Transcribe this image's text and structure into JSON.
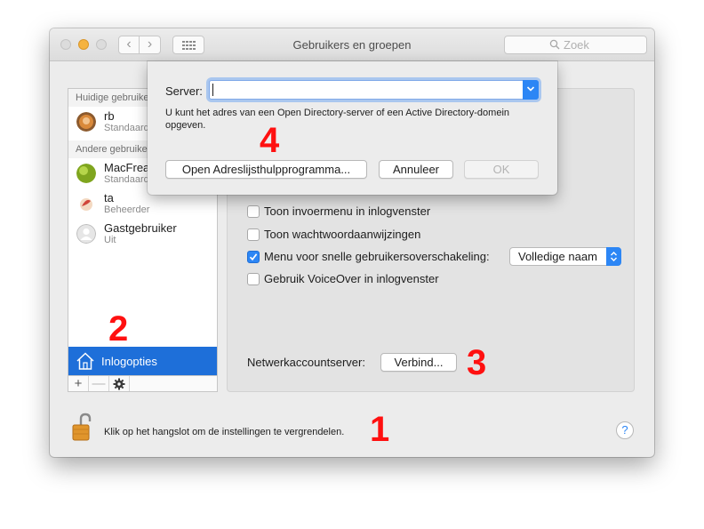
{
  "window": {
    "title": "Gebruikers en groepen",
    "search_placeholder": "Zoek"
  },
  "sidebar": {
    "current_header": "Huidige gebruiker",
    "other_header": "Andere gebruikers",
    "current_user": {
      "name": "rb",
      "role": "Standaard"
    },
    "users": [
      {
        "name": "MacFreak",
        "role": "Standaard"
      },
      {
        "name": "ta",
        "role": "Beheerder"
      },
      {
        "name": "Gastgebruiker",
        "role": "Uit"
      }
    ],
    "login_options": "Inlogopties",
    "tools": {
      "add": "+",
      "remove": "—"
    }
  },
  "panel": {
    "options": [
      {
        "label": "Toon invoermenu in inlogvenster",
        "checked": false
      },
      {
        "label": "Toon wachtwoordaanwijzingen",
        "checked": false
      },
      {
        "label": "Menu voor snelle gebruikersoverschakeling:",
        "checked": true
      },
      {
        "label": "Gebruik VoiceOver in inlogvenster",
        "checked": false
      }
    ],
    "fast_switch_value": "Volledige naam",
    "network_label": "Netwerkaccountserver:",
    "join_button": "Verbind..."
  },
  "footer": {
    "lock_text": "Klik op het hangslot om de instellingen te vergrendelen.",
    "help": "?"
  },
  "sheet": {
    "server_label": "Server:",
    "server_value": "",
    "help_text": "U kunt het adres van een Open Directory-server of een Active Directory-domein opgeven.",
    "open_utility_button": "Open Adreslijsthulpprogramma...",
    "cancel_button": "Annuleer",
    "ok_button": "OK"
  },
  "annotations": {
    "n1": "1",
    "n2": "2",
    "n3": "3",
    "n4": "4"
  },
  "colors": {
    "selection": "#1e6fd9",
    "accent": "#2c86f5",
    "annotation": "#ff1010"
  }
}
